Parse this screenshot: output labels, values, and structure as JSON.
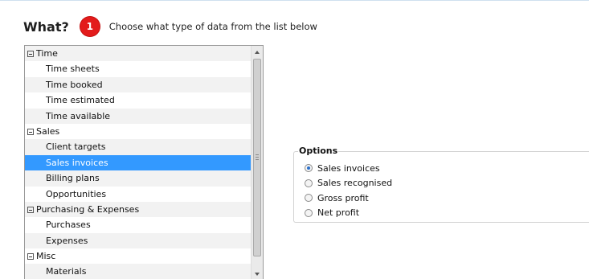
{
  "header": {
    "title": "What?",
    "step": "1",
    "description": "Choose what type of data from the list below"
  },
  "data_list": {
    "selected": "Sales invoices",
    "rows": [
      {
        "label": "Time",
        "kind": "group"
      },
      {
        "label": "Time sheets",
        "kind": "item"
      },
      {
        "label": "Time booked",
        "kind": "item"
      },
      {
        "label": "Time estimated",
        "kind": "item"
      },
      {
        "label": "Time available",
        "kind": "item"
      },
      {
        "label": "Sales",
        "kind": "group"
      },
      {
        "label": "Client targets",
        "kind": "item"
      },
      {
        "label": "Sales invoices",
        "kind": "item"
      },
      {
        "label": "Billing plans",
        "kind": "item"
      },
      {
        "label": "Opportunities",
        "kind": "item"
      },
      {
        "label": "Purchasing & Expenses",
        "kind": "group"
      },
      {
        "label": "Purchases",
        "kind": "item"
      },
      {
        "label": "Expenses",
        "kind": "item"
      },
      {
        "label": "Misc",
        "kind": "group"
      },
      {
        "label": "Materials",
        "kind": "item"
      }
    ]
  },
  "options": {
    "legend": "Options",
    "selected": "Sales invoices",
    "items": [
      "Sales invoices",
      "Sales recognised",
      "Gross profit",
      "Net profit"
    ]
  },
  "colors": {
    "selection": "#3399ff",
    "badge": "#e31b1b"
  }
}
